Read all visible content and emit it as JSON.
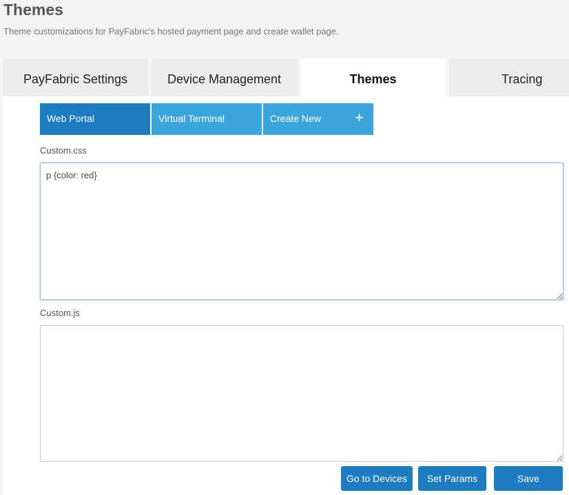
{
  "header": {
    "title": "Themes",
    "subtitle": "Theme customizations for PayFabric's hosted payment page and create wallet page."
  },
  "tabs": [
    {
      "label": "PayFabric Settings",
      "active": false
    },
    {
      "label": "Device Management",
      "active": false
    },
    {
      "label": "Themes",
      "active": true
    },
    {
      "label": "Tracing",
      "active": false
    }
  ],
  "subtabs": [
    {
      "label": "Web Portal",
      "active": true
    },
    {
      "label": "Virtual Terminal",
      "active": false
    },
    {
      "label": "Create New",
      "icon": "plus-icon",
      "icon_glyph": "+"
    }
  ],
  "fields": {
    "css": {
      "label": "Custom.css",
      "value": "p {color: red}"
    },
    "js": {
      "label": "Custom.js",
      "value": ""
    }
  },
  "buttons": {
    "go_to_devices": "Go to Devices",
    "set_params": "Set Params",
    "save": "Save"
  },
  "colors": {
    "primary": "#1e7cc0",
    "subtab": "#3aa6dc",
    "tab_inactive": "#ececec",
    "background": "#f3f3f3"
  }
}
